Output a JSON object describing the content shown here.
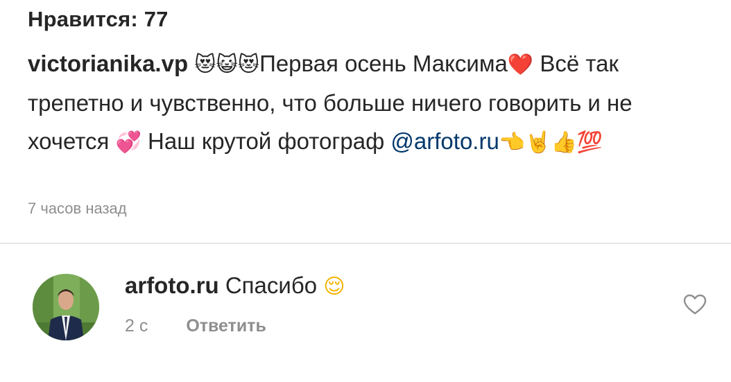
{
  "likes": {
    "text": "Нравится: 77"
  },
  "caption": {
    "author": "victorianika.vp",
    "emoji_cats": "😻😺😻",
    "text_1": "Первая осень Максима",
    "emoji_heart": "❤️",
    "text_2": " Всё так трепетно и чувственно, что больше ничего говорить и не хочется ",
    "emoji_hearts": "💞",
    "text_3": " Наш крутой фотограф ",
    "mention": "@arfoto.ru",
    "emoji_end": "👈🤘👍💯"
  },
  "timestamp": "7 часов назад",
  "reply": {
    "avatar": "avatar",
    "author": "arfoto.ru",
    "text": "Спасибо",
    "emoji": "😌",
    "time": "2 с",
    "reply_label": "Ответить"
  },
  "icons": {
    "like": "heart-outline-icon"
  },
  "colors": {
    "text": "#262626",
    "secondary": "#8e8e8e",
    "mention": "#00376b",
    "divider": "#e6e6e6"
  }
}
